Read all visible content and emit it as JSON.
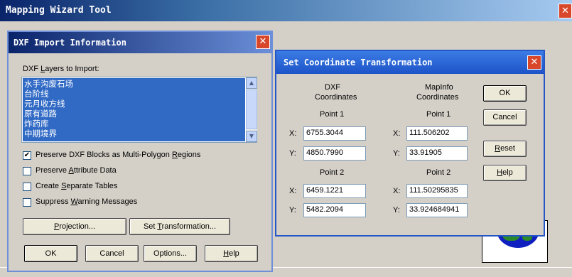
{
  "main_window": {
    "title": "Mapping Wizard Tool"
  },
  "dxf_dialog": {
    "title": "DXF Import Information",
    "layers_label_pre": "DXF ",
    "layers_label_u": "L",
    "layers_label_post": "ayers to Import:",
    "layers": [
      "水手沟废石场",
      "台阶线",
      "元月收方线",
      "原有道路",
      "炸药库",
      "中期境界"
    ],
    "options": [
      {
        "pre": "Preserve DXF Blocks as Multi-Polygon ",
        "u": "R",
        "post": "egions",
        "checked": true
      },
      {
        "pre": "Preserve ",
        "u": "A",
        "post": "ttribute Data",
        "checked": false
      },
      {
        "pre": "Create ",
        "u": "S",
        "post": "eparate Tables",
        "checked": false
      },
      {
        "pre": "Suppress ",
        "u": "W",
        "post": "arning Messages",
        "checked": false
      }
    ],
    "projection_pre": "",
    "projection_u": "P",
    "projection_post": "rojection...",
    "set_transform_pre": "Set ",
    "set_transform_u": "T",
    "set_transform_post": "ransformation...",
    "ok": "OK",
    "cancel": "Cancel",
    "options_btn": "Options...",
    "help_pre": "",
    "help_u": "H",
    "help_post": "elp"
  },
  "transform_dialog": {
    "title": "Set Coordinate Transformation",
    "dxf_header": [
      "DXF",
      "Coordinates"
    ],
    "mapinfo_header": [
      "MapInfo",
      "Coordinates"
    ],
    "point1": "Point 1",
    "point2": "Point 2",
    "x_label": "X:",
    "y_label": "Y:",
    "dxf_p1": {
      "x": "6755.3044",
      "y": "4850.7990"
    },
    "dxf_p2": {
      "x": "6459.1221",
      "y": "5482.2094"
    },
    "mi_p1": {
      "x": "111.506202",
      "y": "33.91905"
    },
    "mi_p2": {
      "x": "111.50295835",
      "y": "33.924684941"
    },
    "ok": "OK",
    "cancel": "Cancel",
    "reset_pre": "",
    "reset_u": "R",
    "reset_post": "eset",
    "help_pre": "",
    "help_u": "H",
    "help_post": "elp"
  },
  "colors": {
    "titlebar": "#0a246a",
    "selection": "#316ac5",
    "dialog_bg": "#d4d0c8",
    "border_blue": "#2457c5"
  }
}
